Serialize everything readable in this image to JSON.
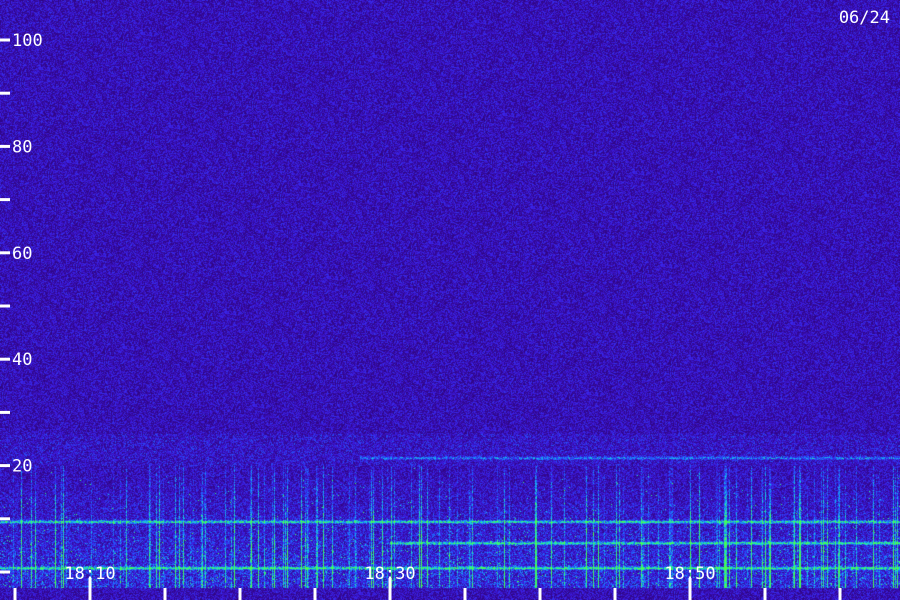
{
  "chart_data": {
    "type": "heatmap",
    "title": "",
    "date_label": "06/24",
    "xlabel": "",
    "ylabel": "",
    "ylim": [
      0,
      102
    ],
    "xlim": [
      "18:04",
      "19:04"
    ],
    "y_ticks": [
      0,
      10,
      20,
      30,
      40,
      50,
      60,
      70,
      80,
      90,
      100
    ],
    "y_tick_labels": [
      {
        "value": 20,
        "label": "20"
      },
      {
        "value": 40,
        "label": "40"
      },
      {
        "value": 60,
        "label": "60"
      },
      {
        "value": 80,
        "label": "80"
      },
      {
        "value": 100,
        "label": "100"
      }
    ],
    "x_ticks_major": [
      "18:10",
      "18:30",
      "18:50"
    ],
    "x_ticks_minor": [
      "18:05",
      "18:15",
      "18:20",
      "18:25",
      "18:35",
      "18:40",
      "18:45",
      "18:55",
      "19:00"
    ],
    "grid": false,
    "colors": {
      "background": "#3a0c8c",
      "noise_low": "#2a0060",
      "noise_high": "#3c18d8",
      "signal_mid": "#1a6cff",
      "signal_high": "#18d0e0",
      "signal_peak": "#3cff5a",
      "text": "#ffffff"
    },
    "features": [
      {
        "kind": "horizontal-line",
        "y": 21.5,
        "x_start": "18:28",
        "x_end": "19:04",
        "intensity": "mid"
      },
      {
        "kind": "band",
        "y_from": 0,
        "y_to": 20,
        "intensity": "high"
      },
      {
        "kind": "horizontal-line",
        "y": 9.5,
        "x_start": "18:04",
        "x_end": "19:04",
        "intensity": "peak"
      },
      {
        "kind": "horizontal-line",
        "y": 5.5,
        "x_start": "18:30",
        "x_end": "19:04",
        "intensity": "peak"
      },
      {
        "kind": "horizontal-line",
        "y": 0.8,
        "x_start": "18:04",
        "x_end": "19:04",
        "intensity": "peak"
      }
    ]
  }
}
